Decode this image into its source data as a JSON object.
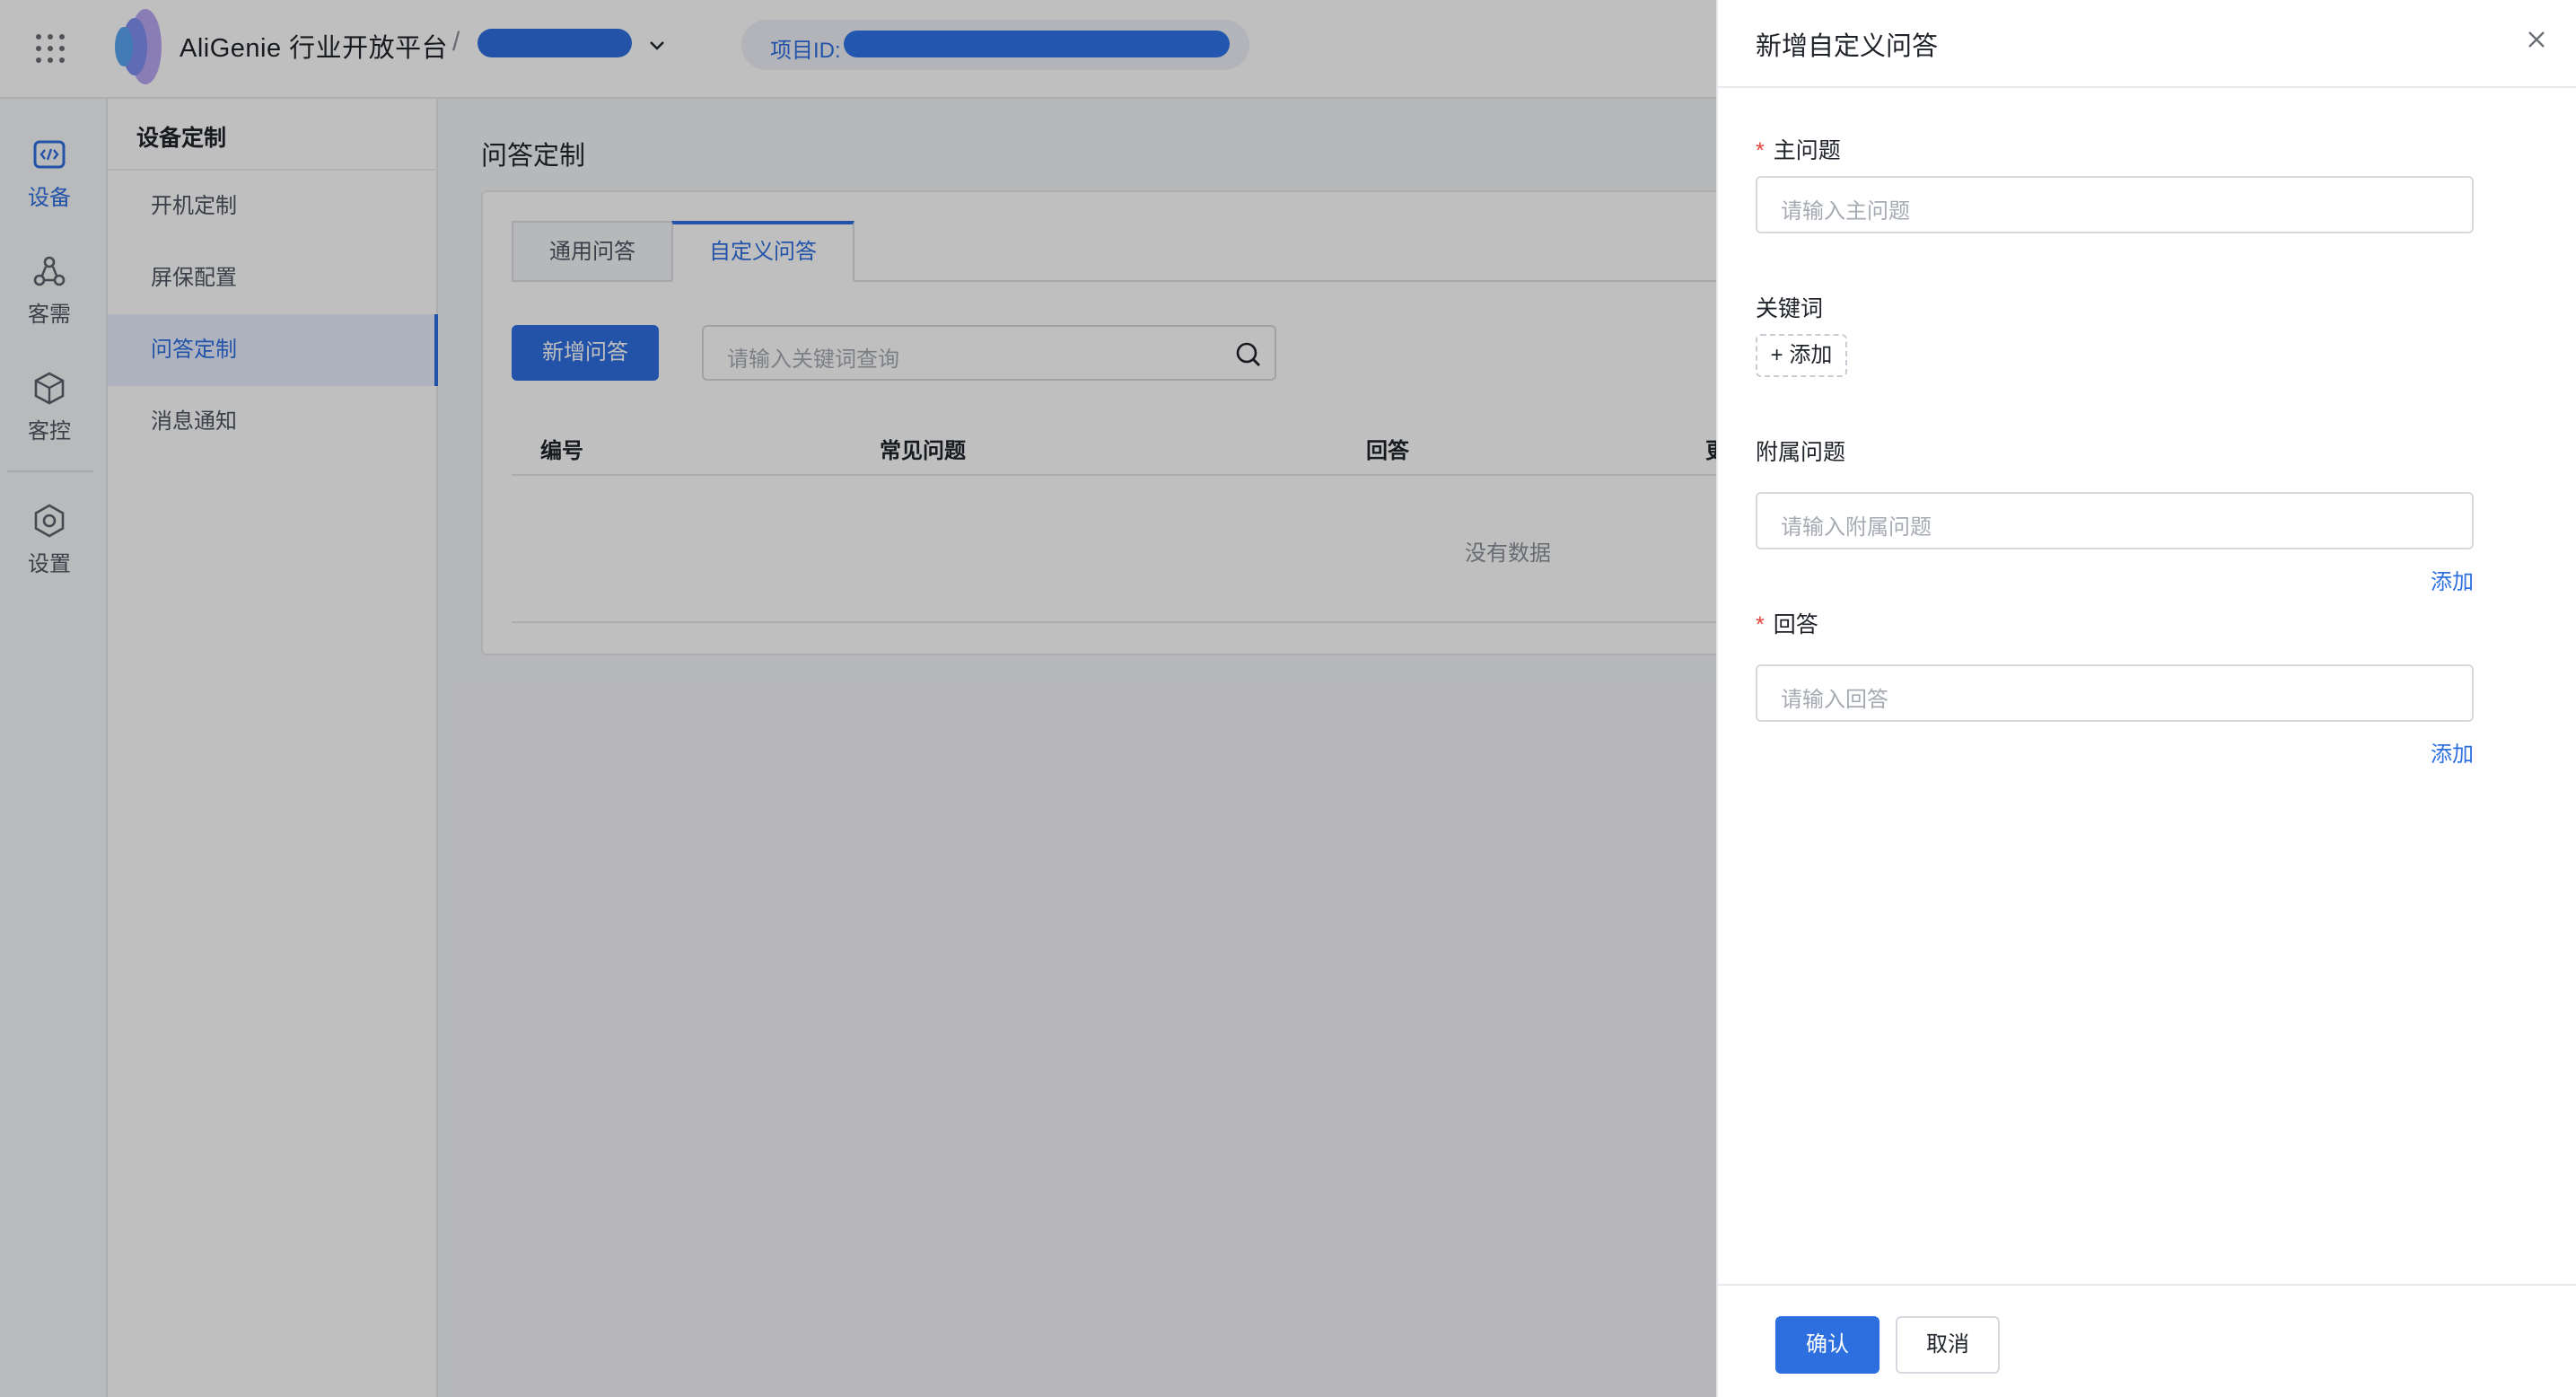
{
  "header": {
    "app_title": "AliGenie 行业开放平台",
    "separator": "/",
    "project_id_label": "项目ID:"
  },
  "leftnav": {
    "items": [
      {
        "label": "设备",
        "icon": "code-icon"
      },
      {
        "label": "客需",
        "icon": "nodes-icon"
      },
      {
        "label": "客控",
        "icon": "cube-icon"
      },
      {
        "label": "设置",
        "icon": "gear-hex-icon"
      }
    ]
  },
  "subnav": {
    "title": "设备定制",
    "items": [
      "开机定制",
      "屏保配置",
      "问答定制",
      "消息通知"
    ],
    "active": "问答定制"
  },
  "main": {
    "title": "问答定制",
    "tabs": [
      "通用问答",
      "自定义问答"
    ],
    "active_tab": "自定义问答",
    "add_button": "新增问答",
    "search_placeholder": "请输入关键词查询",
    "columns": [
      "编号",
      "常见问题",
      "回答",
      "更"
    ],
    "empty_text": "没有数据"
  },
  "drawer": {
    "title": "新增自定义问答",
    "main_question": {
      "required": "*",
      "label": "主问题",
      "placeholder": "请输入主问题"
    },
    "keywords": {
      "label": "关键词",
      "add_tag": "+ 添加"
    },
    "sub_question": {
      "label": "附属问题",
      "placeholder": "请输入附属问题",
      "add_link": "添加"
    },
    "answer": {
      "required": "*",
      "label": "回答",
      "placeholder": "请输入回答",
      "add_link": "添加"
    },
    "confirm": "确认",
    "cancel": "取消"
  },
  "colors": {
    "accent": "#2e6fe0",
    "required": "#e3413b",
    "overlay": "rgba(0,0,0,0.25)"
  }
}
